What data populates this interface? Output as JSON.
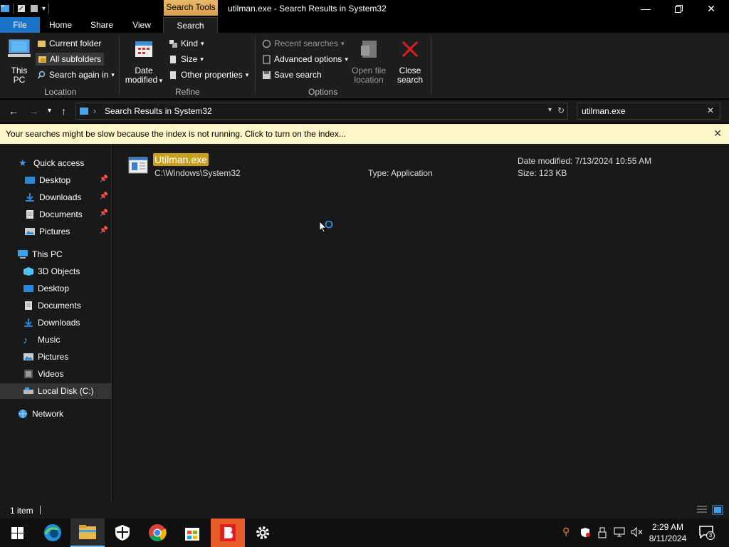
{
  "window": {
    "title": "utilman.exe - Search Results in System32",
    "context_tab": "Search Tools",
    "min_icon": "minimize-icon",
    "max_icon": "restore-icon",
    "close_icon": "close-icon"
  },
  "tabs": {
    "file": "File",
    "home": "Home",
    "share": "Share",
    "view": "View",
    "search": "Search"
  },
  "ribbon": {
    "location": {
      "label": "Location",
      "this_pc": "This PC",
      "current_folder": "Current folder",
      "all_subfolders": "All subfolders",
      "search_again": "Search again in"
    },
    "refine": {
      "label": "Refine",
      "date_modified_1": "Date",
      "date_modified_2": "modified",
      "kind": "Kind",
      "size": "Size",
      "other_properties": "Other properties"
    },
    "options": {
      "label": "Options",
      "recent_searches": "Recent searches",
      "advanced_options": "Advanced options",
      "save_search": "Save search",
      "open_file_location_1": "Open file",
      "open_file_location_2": "location",
      "close_search_1": "Close",
      "close_search_2": "search"
    }
  },
  "address": {
    "path": "Search Results in System32",
    "search_value": "utilman.exe"
  },
  "infobar": {
    "message": "Your searches might be slow because the index is not running.  Click to turn on the index..."
  },
  "nav": {
    "quick_access": "Quick access",
    "qa_items": [
      "Desktop",
      "Downloads",
      "Documents",
      "Pictures"
    ],
    "this_pc": "This PC",
    "pc_items": [
      "3D Objects",
      "Desktop",
      "Documents",
      "Downloads",
      "Music",
      "Pictures",
      "Videos",
      "Local Disk (C:)"
    ],
    "network": "Network"
  },
  "result": {
    "name": "Utilman.exe",
    "path": "C:\\Windows\\System32",
    "type": "Type: Application",
    "date": "Date modified: 7/13/2024 10:55 AM",
    "size": "Size: 123 KB"
  },
  "status": {
    "count": "1 item"
  },
  "taskbar": {
    "time": "2:29 AM",
    "date": "8/11/2024",
    "notifications": "3"
  },
  "colors": {
    "accent": "#1a73c8",
    "highlight": "#c8a020",
    "infobar": "#fdf4c7"
  }
}
